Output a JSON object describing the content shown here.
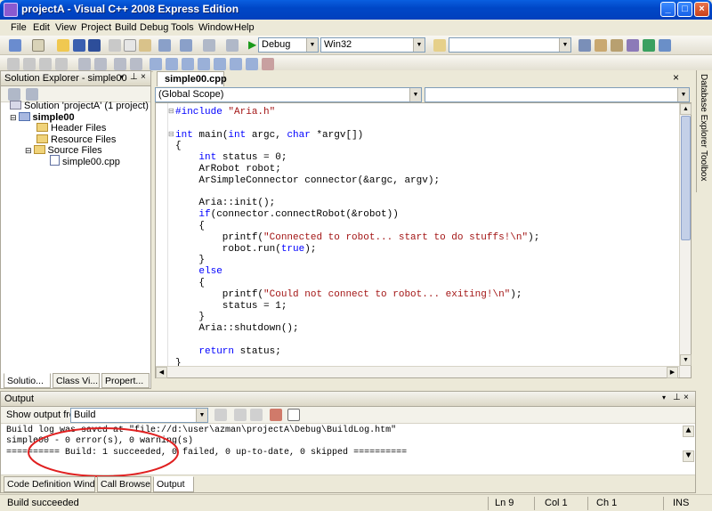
{
  "window": {
    "title": "projectA - Visual C++ 2008 Express Edition"
  },
  "menu": [
    "File",
    "Edit",
    "View",
    "Project",
    "Build",
    "Debug",
    "Tools",
    "Window",
    "Help"
  ],
  "toolbar": {
    "config": "Debug",
    "platform": "Win32"
  },
  "solution_explorer": {
    "title": "Solution Explorer - simple00",
    "solution": "Solution 'projectA' (1 project)",
    "project": "simple00",
    "folders": [
      "Header Files",
      "Resource Files",
      "Source Files"
    ],
    "file": "simple00.cpp",
    "tabs": [
      "Solutio...",
      "Class Vi...",
      "Propert..."
    ]
  },
  "side_tabs": [
    "Database Explorer",
    "Toolbox"
  ],
  "editor": {
    "tab": "simple00.cpp",
    "scope": "(Global Scope)",
    "lines": [
      {
        "segs": [
          [
            "kw",
            "#include "
          ],
          [
            "str",
            "\"Aria.h\""
          ]
        ]
      },
      {
        "segs": [
          [
            "",
            "  "
          ]
        ]
      },
      {
        "segs": [
          [
            "kw",
            "int"
          ],
          [
            "",
            " main("
          ],
          [
            "kw",
            "int"
          ],
          [
            "",
            " argc, "
          ],
          [
            "kw",
            "char"
          ],
          [
            "",
            " *argv[])"
          ]
        ]
      },
      {
        "segs": [
          [
            "",
            "{"
          ]
        ]
      },
      {
        "segs": [
          [
            "",
            "    "
          ],
          [
            "kw",
            "int"
          ],
          [
            "",
            " status = 0;"
          ]
        ]
      },
      {
        "segs": [
          [
            "",
            "    ArRobot robot;"
          ]
        ]
      },
      {
        "segs": [
          [
            "",
            "    ArSimpleConnector connector(&argc, argv);"
          ]
        ]
      },
      {
        "segs": [
          [
            "",
            ""
          ]
        ]
      },
      {
        "segs": [
          [
            "",
            "    Aria::init();"
          ]
        ]
      },
      {
        "segs": [
          [
            "",
            "    "
          ],
          [
            "kw",
            "if"
          ],
          [
            "",
            "(connector.connectRobot(&robot))"
          ]
        ]
      },
      {
        "segs": [
          [
            "",
            "    {"
          ]
        ]
      },
      {
        "segs": [
          [
            "",
            "        printf("
          ],
          [
            "str",
            "\"Connected to robot... start to do stuffs!\\n\""
          ],
          [
            "",
            ");"
          ]
        ]
      },
      {
        "segs": [
          [
            "",
            "        robot.run("
          ],
          [
            "kw",
            "true"
          ],
          [
            "",
            ");"
          ]
        ]
      },
      {
        "segs": [
          [
            "",
            "    }"
          ]
        ]
      },
      {
        "segs": [
          [
            "",
            "    "
          ],
          [
            "kw",
            "else"
          ]
        ]
      },
      {
        "segs": [
          [
            "",
            "    {"
          ]
        ]
      },
      {
        "segs": [
          [
            "",
            "        printf("
          ],
          [
            "str",
            "\"Could not connect to robot... exiting!\\n\""
          ],
          [
            "",
            ");"
          ]
        ]
      },
      {
        "segs": [
          [
            "",
            "        status = 1;"
          ]
        ]
      },
      {
        "segs": [
          [
            "",
            "    }"
          ]
        ]
      },
      {
        "segs": [
          [
            "",
            "    Aria::shutdown();"
          ]
        ]
      },
      {
        "segs": [
          [
            "",
            ""
          ]
        ]
      },
      {
        "segs": [
          [
            "",
            "    "
          ],
          [
            "kw",
            "return"
          ],
          [
            "",
            " status;"
          ]
        ]
      },
      {
        "segs": [
          [
            "",
            "}"
          ]
        ]
      }
    ]
  },
  "output": {
    "title": "Output",
    "show_from_label": "Show output from:",
    "show_from_value": "Build",
    "lines": [
      "Build log was saved at \"file://d:\\user\\azman\\projectA\\Debug\\BuildLog.htm\"",
      "simple00 - 0 error(s), 0 warning(s)",
      "========== Build: 1 succeeded, 0 failed, 0 up-to-date, 0 skipped =========="
    ],
    "tabs": [
      "Code Definition Window",
      "Call Browser",
      "Output"
    ]
  },
  "status": {
    "message": "Build succeeded",
    "ln": "Ln 9",
    "col": "Col 1",
    "ch": "Ch 1",
    "mode": "INS"
  },
  "colors": {
    "keyword": "#0000ff",
    "string": "#a31515",
    "annotation": "#e02020"
  }
}
